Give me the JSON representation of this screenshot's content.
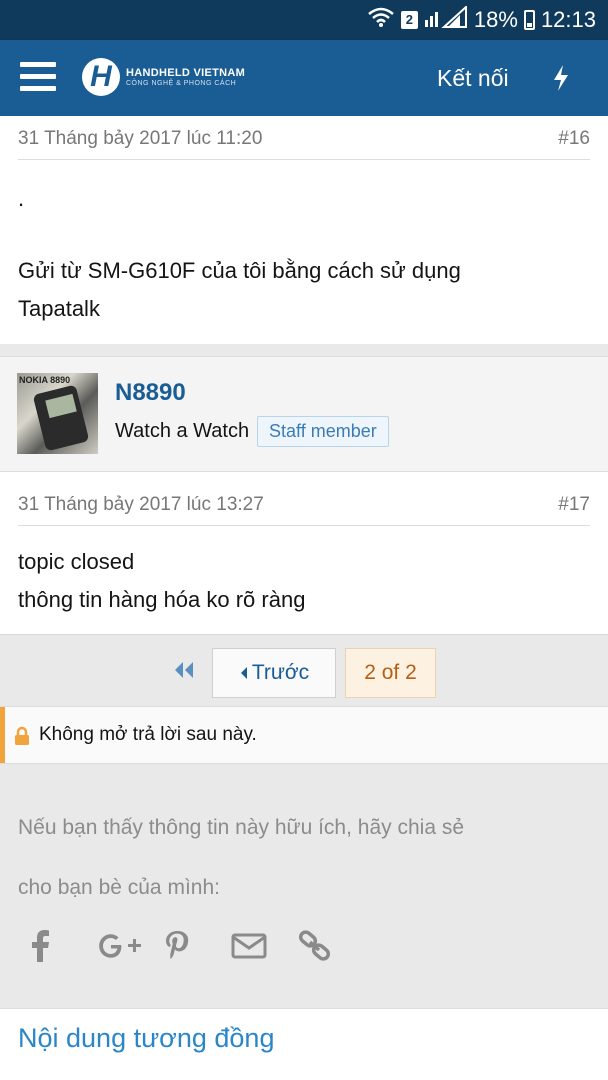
{
  "status_bar": {
    "sim_badge": "2",
    "battery": "18%",
    "time": "12:13"
  },
  "app_header": {
    "logo_letter": "H",
    "logo_title": "HANDHELD VIETNAM",
    "logo_tagline": "CÔNG NGHỆ & PHONG CÁCH",
    "connect_label": "Kết nối",
    "icons": [
      "menu-icon",
      "bolt-icon"
    ]
  },
  "post_16": {
    "date": "31 Tháng bảy 2017 lúc 11:20",
    "number": "#16",
    "line1": ".",
    "line2": "Gửi từ SM-G610F của tôi bằng cách sử dụng",
    "line3": "Tapatalk"
  },
  "user": {
    "avatar_brand": "NOKIA 8890",
    "name": "N8890",
    "title": "Watch a Watch",
    "badge": "Staff member"
  },
  "post_17": {
    "date": "31 Tháng bảy 2017 lúc 13:27",
    "number": "#17",
    "line1": "topic closed",
    "line2": "thông tin hàng hóa ko rõ ràng"
  },
  "pagination": {
    "prev_label": "Trước",
    "current": "2 of 2"
  },
  "locked_notice": {
    "text": "Không mở trả lời sau này."
  },
  "share": {
    "line1": "Nếu bạn thấy thông tin này hữu ích, hãy chia sẻ",
    "line2": "cho bạn bè của mình:",
    "icons": [
      "facebook-icon",
      "google-plus-icon",
      "pinterest-icon",
      "email-icon",
      "link-icon"
    ]
  },
  "related": {
    "title": "Nội dung tương đồng"
  },
  "colors": {
    "status_bar": "#0f3a5c",
    "header": "#1a5d95",
    "link_blue": "#2a86c9",
    "lock_accent": "#f1a33c",
    "current_page_bg": "#fdf1e1",
    "current_page_text": "#b55f14"
  }
}
